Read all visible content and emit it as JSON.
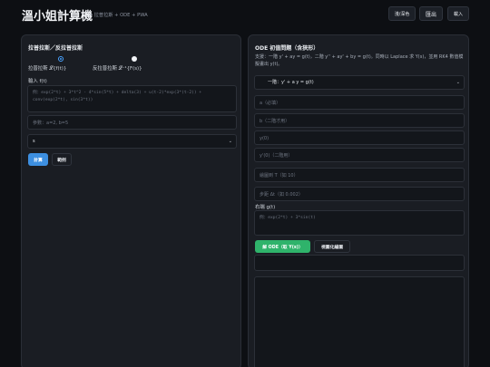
{
  "header": {
    "title": "溫小姐計算機",
    "subtitle": "• 拉普拉斯 + ODE + PWA",
    "theme_button": "淺/深色",
    "export_button": "匯出",
    "import_button": "載入"
  },
  "left": {
    "title": "拉普拉斯／反拉普拉斯",
    "radio_forward_label": "拉普拉斯 𝓛{f(t)}",
    "radio_inverse_label": "反拉普拉斯 𝓛⁻¹{F(s)}",
    "input_label": "輸入 f(t)",
    "expr_placeholder": "例：exp(2*t) + 3*t^2 - 4*sin(5*t) + delta(3) + u(t-2)*exp(3*(t-2)) + conv(exp(2*t), sin(3*t))",
    "params_placeholder": "參數：a=2, b=5",
    "variable_select": "s",
    "calc_button": "計算",
    "example_button": "範例"
  },
  "right": {
    "title": "ODE 初值問題（含狹形）",
    "description": "支援：一階 y' + ay = g(t)，二階 y'' + ay' + by = g(t)。同時以 Laplace 求 Y(s)，並用 RK4 數值模擬畫出 y(t)。",
    "order_select": "一階：y' + a y = g(t)",
    "a_placeholder": "a（必填）",
    "b_placeholder": "b（二階才用）",
    "y0_placeholder": "y(0)",
    "yp0_placeholder": "y'(0)（二階用）",
    "T_placeholder": "繪圖到 T（如 10）",
    "dt_placeholder": "步距 Δt（如 0.002）",
    "rhs_label": "右端 g(t)",
    "rhs_placeholder": "例：exp(2*t) + 3*sin(t)",
    "solve_button": "解 ODE（取 Y(s)）",
    "plot_button": "視圖化繪圖"
  },
  "colors": {
    "accent_blue": "#3d8fe0",
    "accent_green": "#2fb36b",
    "radio_selected": "#4aa3ff"
  }
}
